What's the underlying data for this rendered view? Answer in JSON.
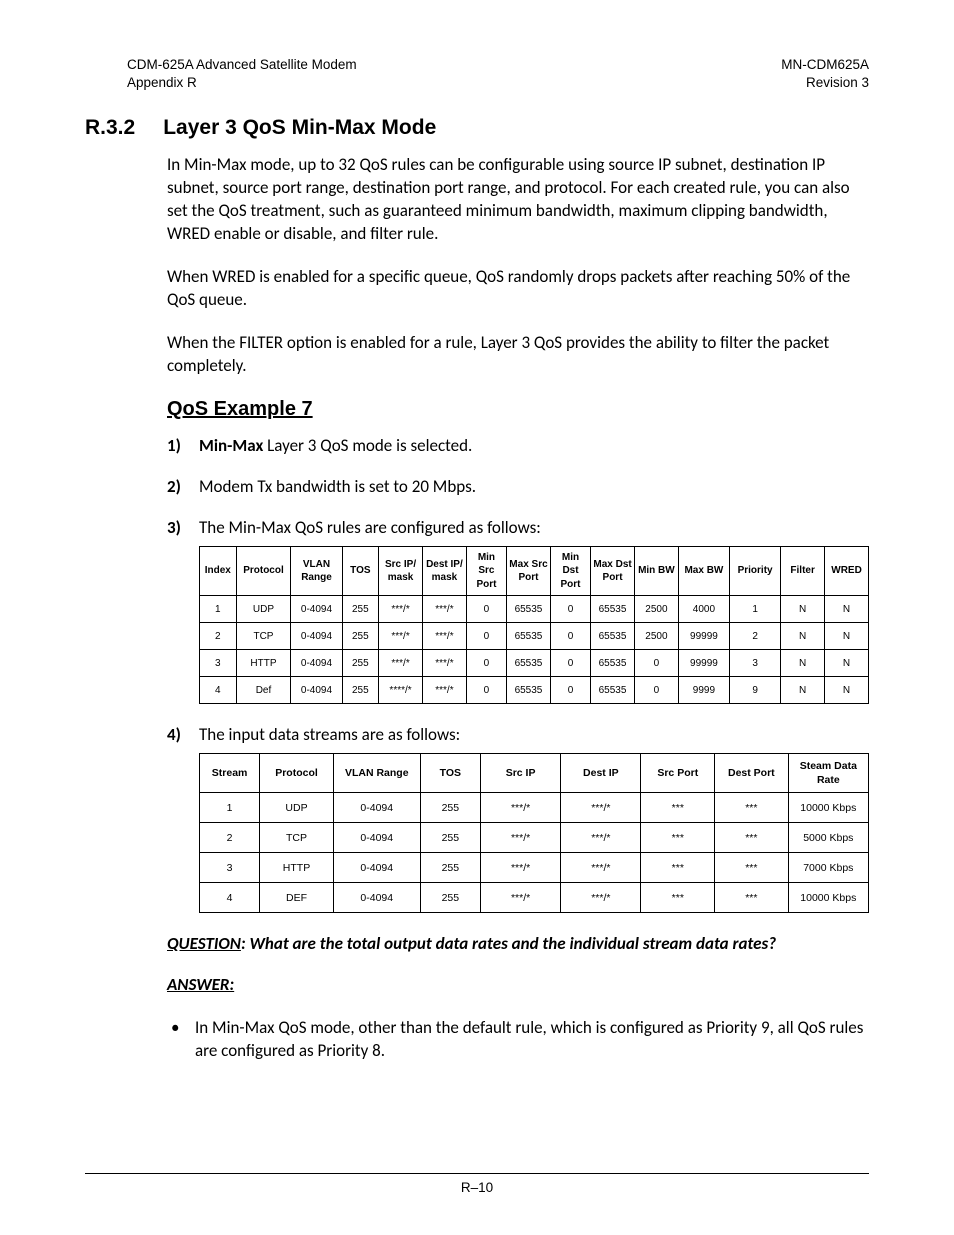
{
  "header": {
    "top_left_1": "CDM-625A Advanced Satellite Modem",
    "top_left_2": "Appendix R",
    "top_right_1": "MN-CDM625A",
    "top_right_2": "Revision 3"
  },
  "section": {
    "number": "R.3.2",
    "title": "Layer 3 QoS Min-Max Mode"
  },
  "paras": {
    "p1": "In Min-Max mode, up to 32 QoS rules can be configurable using source IP subnet, destination IP subnet, source port range, destination port range, and protocol. For each created rule, you can also set the QoS treatment, such as guaranteed minimum bandwidth, maximum clipping bandwidth, WRED enable or disable, and filter rule.",
    "p2": "When WRED is enabled for a specific queue, QoS randomly drops packets after reaching 50% of the QoS queue.",
    "p3": "When the FILTER option is enabled for a rule, Layer 3 QoS provides the ability to filter the packet completely."
  },
  "example_title": "QoS Example 7",
  "steps": {
    "s1_prefix": "Min-Max",
    "s1_rest": " Layer 3 QoS mode is selected.",
    "s2": "Modem Tx bandwidth is set to 20 Mbps.",
    "s3": "The Min-Max QoS rules are configured as follows:",
    "s4": "The input data streams are as follows:"
  },
  "table1": {
    "headers": [
      "Index",
      "Protocol",
      "VLAN Range",
      "TOS",
      "Src IP/ mask",
      "Dest IP/ mask",
      "Min Src Port",
      "Max Src Port",
      "Min Dst Port",
      "Max Dst Port",
      "Min BW",
      "Max BW",
      "Priority",
      "Filter",
      "WRED"
    ],
    "rows": [
      [
        "1",
        "UDP",
        "0-4094",
        "255",
        "***/*",
        "***/*",
        "0",
        "65535",
        "0",
        "65535",
        "2500",
        "4000",
        "1",
        "N",
        "N"
      ],
      [
        "2",
        "TCP",
        "0-4094",
        "255",
        "***/*",
        "***/*",
        "0",
        "65535",
        "0",
        "65535",
        "2500",
        "99999",
        "2",
        "N",
        "N"
      ],
      [
        "3",
        "HTTP",
        "0-4094",
        "255",
        "***/*",
        "***/*",
        "0",
        "65535",
        "0",
        "65535",
        "0",
        "99999",
        "3",
        "N",
        "N"
      ],
      [
        "4",
        "Def",
        "0-4094",
        "255",
        "****/*",
        "***/*",
        "0",
        "65535",
        "0",
        "65535",
        "0",
        "9999",
        "9",
        "N",
        "N"
      ]
    ]
  },
  "table2": {
    "headers": [
      "Stream",
      "Protocol",
      "VLAN Range",
      "TOS",
      "Src IP",
      "Dest IP",
      "Src Port",
      "Dest Port",
      "Steam Data Rate"
    ],
    "rows": [
      [
        "1",
        "UDP",
        "0-4094",
        "255",
        "***/*",
        "***/*",
        "***",
        "***",
        "10000 Kbps"
      ],
      [
        "2",
        "TCP",
        "0-4094",
        "255",
        "***/*",
        "***/*",
        "***",
        "***",
        "5000 Kbps"
      ],
      [
        "3",
        "HTTP",
        "0-4094",
        "255",
        "***/*",
        "***/*",
        "***",
        "***",
        "7000 Kbps"
      ],
      [
        "4",
        "DEF",
        "0-4094",
        "255",
        "***/*",
        "***/*",
        "***",
        "***",
        "10000 Kbps"
      ]
    ]
  },
  "qa": {
    "question_label": "QUESTION",
    "question_text": ": What are the total output data rates and the individual stream data rates?",
    "answer_label": "ANSWER:",
    "bullet1": "In Min-Max QoS mode, other than the default rule, which is configured as Priority 9, all QoS rules are configured as Priority 8."
  },
  "footer": "R–10"
}
